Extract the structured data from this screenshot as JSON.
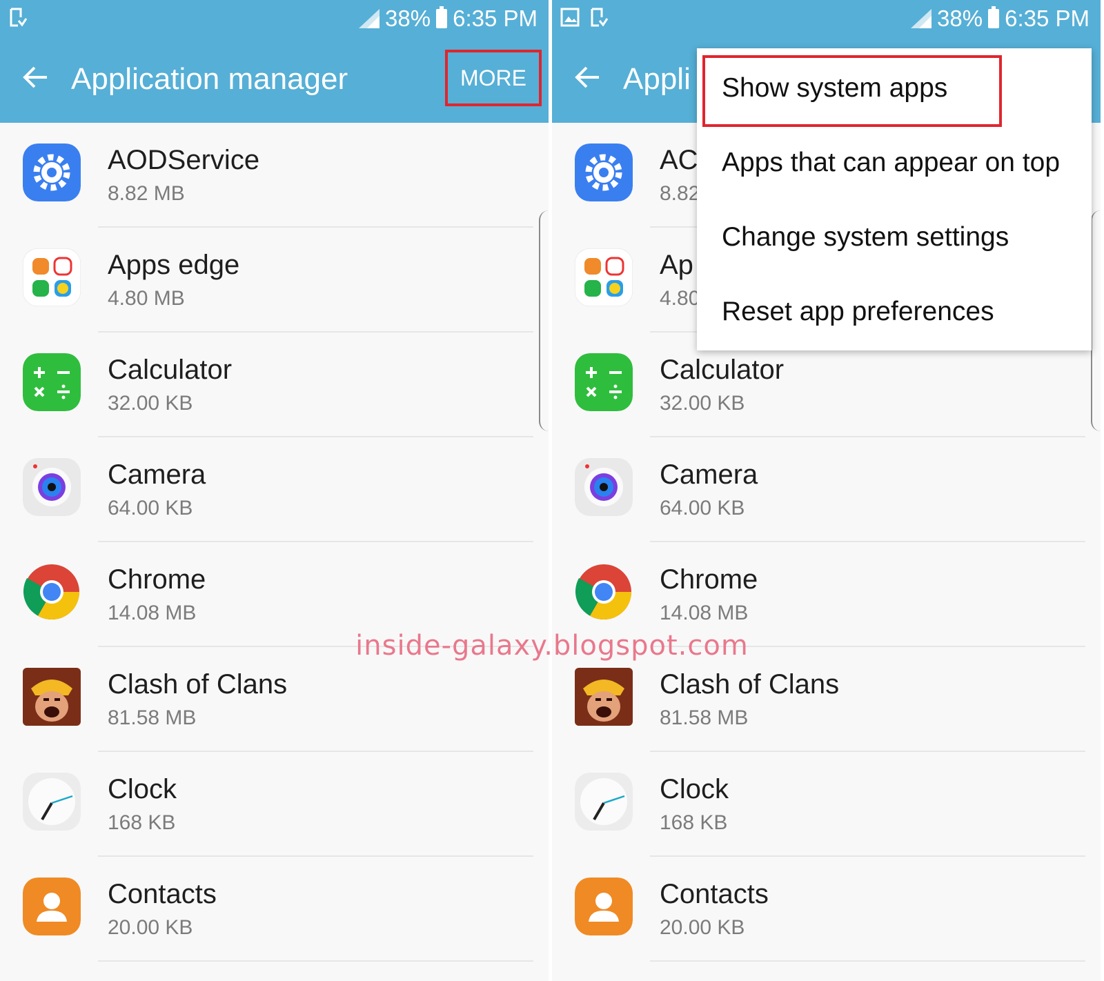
{
  "status_bar": {
    "battery": "38%",
    "time": "6:35 PM"
  },
  "app_bar": {
    "title": "Application manager",
    "title_partial": "Appli",
    "more_label": "MORE"
  },
  "apps": [
    {
      "name": "AODService",
      "size": "8.82 MB",
      "icon": "gear-icon"
    },
    {
      "name": "Apps edge",
      "size": "4.80 MB",
      "icon": "apps-edge-icon"
    },
    {
      "name": "Calculator",
      "size": "32.00 KB",
      "icon": "calculator-icon"
    },
    {
      "name": "Camera",
      "size": "64.00 KB",
      "icon": "camera-icon"
    },
    {
      "name": "Chrome",
      "size": "14.08 MB",
      "icon": "chrome-icon"
    },
    {
      "name": "Clash of Clans",
      "size": "81.58 MB",
      "icon": "clash-of-clans-icon"
    },
    {
      "name": "Clock",
      "size": "168 KB",
      "icon": "clock-icon"
    },
    {
      "name": "Contacts",
      "size": "20.00 KB",
      "icon": "contacts-icon"
    }
  ],
  "right_partial": {
    "app0_name": "AC",
    "app0_size": "8.82",
    "app1_name": "Ap",
    "app1_size": "4.80"
  },
  "menu": {
    "items": [
      "Show system apps",
      "Apps that can appear on top",
      "Change system settings",
      "Reset app preferences"
    ]
  },
  "watermark": "inside-galaxy.blogspot.com",
  "colors": {
    "app_bar": "#56afd6",
    "highlight": "#e0252e",
    "watermark": "#e9788c"
  }
}
